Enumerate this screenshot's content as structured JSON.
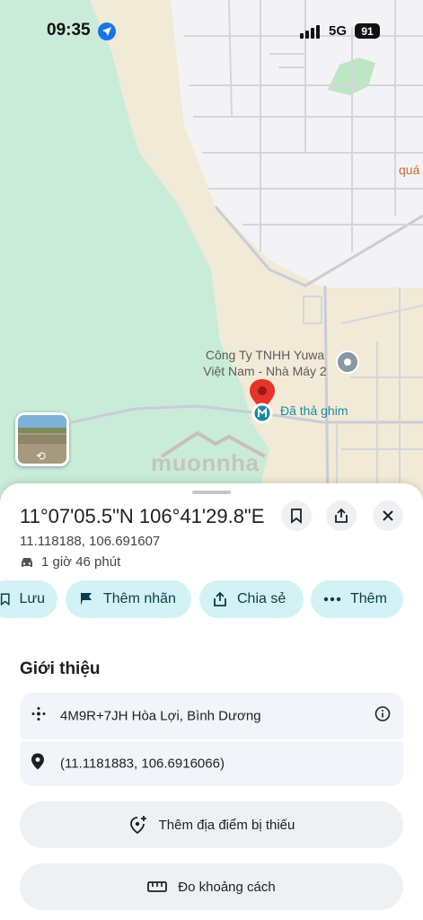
{
  "status_bar": {
    "time": "09:35",
    "network": "5G",
    "battery": "91"
  },
  "map": {
    "poi_label": "Công Ty TNHH Yuwa Việt Nam - Nhà Máy 2",
    "poi_label_line1": "Công Ty TNHH Yuwa",
    "poi_label_line2": "Việt Nam - Nhà Máy 2",
    "edge_label": "quá",
    "dropped_pin_label": "Đã thả ghim",
    "watermark": "muonnha",
    "colors": {
      "green_area": "#c9ecd9",
      "sand": "#f1ead6",
      "road": "#c8cdd6",
      "pin": "#e5352b",
      "teal": "#1a8aa0"
    }
  },
  "place": {
    "coordinates_dms": "11°07'05.5\"N 106°41'29.8\"E",
    "coordinates_decimal": "11.118188, 106.691607",
    "drive_time": "1 giờ 46 phút"
  },
  "actions": {
    "save_label": "Lưu",
    "add_label_label": "Thêm nhãn",
    "share_label": "Chia sẻ",
    "more_label": "Thêm"
  },
  "about": {
    "title": "Giới thiệu",
    "plus_code": "4M9R+7JH Hòa Lợi, Bình Dương",
    "precise_coords": "(11.1181883, 106.6916066)",
    "add_missing_place": "Thêm địa điểm bị thiếu",
    "measure_distance": "Đo khoảng cách"
  }
}
